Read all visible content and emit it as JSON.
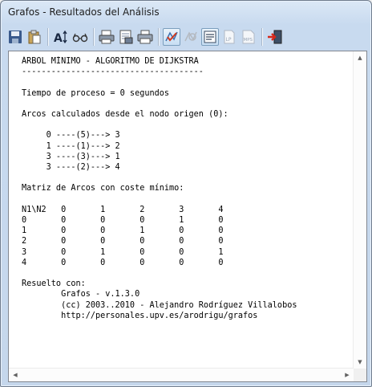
{
  "window": {
    "title": "Grafos - Resultados del Análisis"
  },
  "toolbar": {
    "buttons": [
      {
        "icon": "save-icon"
      },
      {
        "icon": "paste-icon"
      },
      {
        "icon": "font-size-icon"
      },
      {
        "icon": "glasses-icon"
      },
      {
        "icon": "print-preview-icon"
      },
      {
        "icon": "print-setup-icon"
      },
      {
        "icon": "print-icon"
      },
      {
        "icon": "check-graph-icon"
      },
      {
        "icon": "graph-disabled-icon"
      },
      {
        "icon": "report-icon"
      },
      {
        "icon": "lp-file-icon",
        "label": "LP"
      },
      {
        "icon": "mps-file-icon",
        "label": "MPS"
      },
      {
        "icon": "exit-icon"
      }
    ]
  },
  "report": {
    "lines": [
      "ÁRBOL MÍNIMO - ALGORITMO DE DIJKSTRA",
      "-------------------------------------",
      "",
      "Tiempo de proceso = 0 segundos",
      "",
      "Arcos calculados desde el nodo origen (0):",
      "",
      "     0 ----(5)---> 3",
      "     1 ----(1)---> 2",
      "     3 ----(3)---> 1",
      "     3 ----(2)---> 4",
      "",
      "Matriz de Arcos con coste mínimo:",
      "",
      "N1\\N2   0       1       2       3       4",
      "0       0       0       0       1       0",
      "1       0       0       1       0       0",
      "2       0       0       0       0       0",
      "3       0       1       0       0       1",
      "4       0       0       0       0       0",
      "",
      "Resuelto con:",
      "        Grafos - v.1.3.0",
      "        (cc) 2003..2010 - Alejandro Rodríguez Villalobos",
      "        http://personales.upv.es/arodrigu/grafos"
    ]
  }
}
